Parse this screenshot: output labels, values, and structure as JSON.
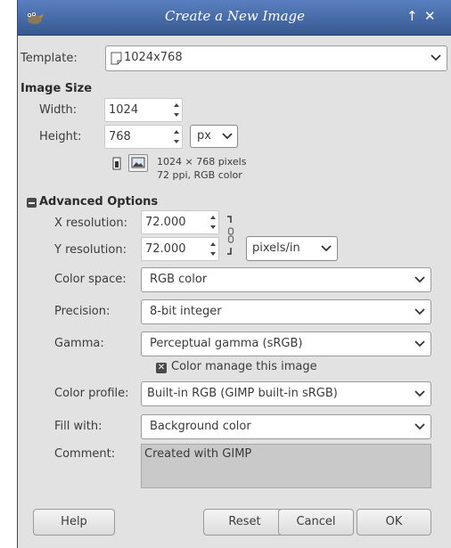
{
  "window": {
    "title": "Create a New Image",
    "pin_glyph": "↑",
    "close_glyph": "✕"
  },
  "template": {
    "label": "Template:",
    "value": "1024x768"
  },
  "image_size": {
    "heading": "Image Size",
    "width_label": "Width:",
    "width_value": "1024",
    "height_label": "Height:",
    "height_value": "768",
    "unit": "px",
    "info_line1": "1024 × 768 pixels",
    "info_line2": "72 ppi, RGB color"
  },
  "advanced": {
    "heading": "Advanced Options",
    "x_res_label": "X resolution:",
    "x_res_value": "72.000",
    "y_res_label": "Y resolution:",
    "y_res_value": "72.000",
    "res_unit": "pixels/in",
    "color_space_label": "Color space:",
    "color_space_value": "RGB color",
    "precision_label": "Precision:",
    "precision_value": "8-bit integer",
    "gamma_label": "Gamma:",
    "gamma_value": "Perceptual gamma (sRGB)",
    "color_manage_label": "Color manage this image",
    "color_manage_checked": true,
    "color_profile_label": "Color profile:",
    "color_profile_value": "Built-in RGB (GIMP built-in sRGB)",
    "fill_label": "Fill with:",
    "fill_value": "Background color",
    "comment_label": "Comment:",
    "comment_value": "Created with GIMP"
  },
  "buttons": {
    "help": "Help",
    "reset": "Reset",
    "cancel": "Cancel",
    "ok": "OK"
  }
}
